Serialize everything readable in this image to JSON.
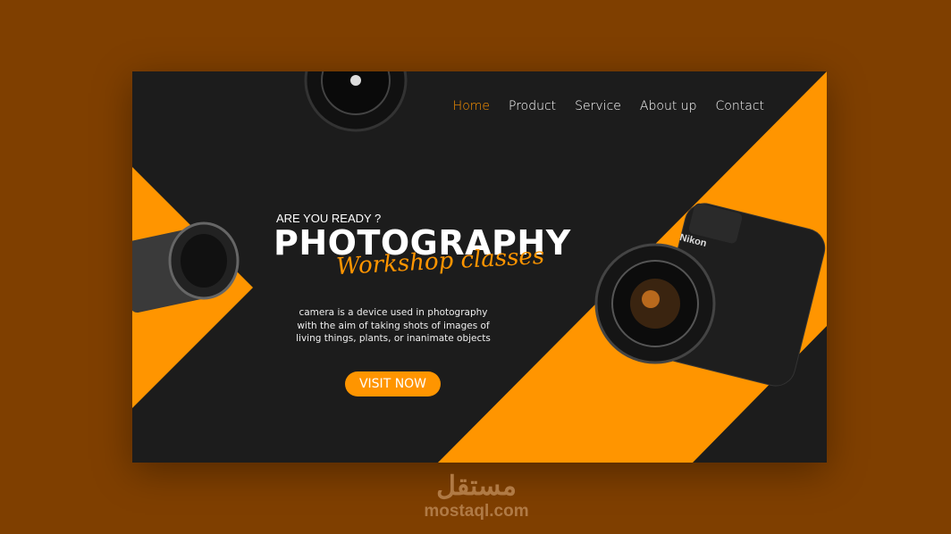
{
  "colors": {
    "accent": "#ff9500",
    "background": "#7f3f00",
    "card": "#1c1c1c"
  },
  "nav": {
    "items": [
      {
        "label": "Home",
        "active": true
      },
      {
        "label": "Product"
      },
      {
        "label": "Service"
      },
      {
        "label": "About up"
      },
      {
        "label": "Contact"
      }
    ]
  },
  "hero": {
    "eyebrow": "ARE YOU READY ?",
    "title": "PHOTOGRAPHY",
    "subtitle": "Workshop classes",
    "description": "camera is a device used in photography with the aim of taking shots of images of living things, plants, or inanimate objects",
    "cta": "VISIT NOW"
  },
  "images": {
    "camera_brand": "Nikon"
  },
  "watermark": {
    "arabic": "مستقل",
    "domain": "mostaql.com"
  }
}
